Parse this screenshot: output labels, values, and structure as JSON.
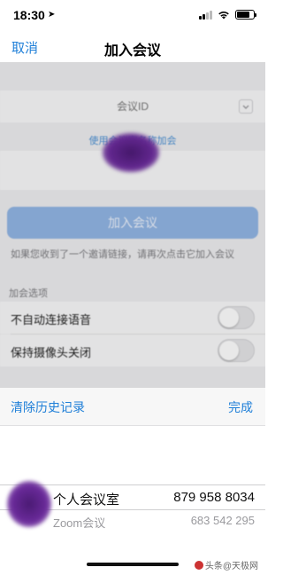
{
  "status": {
    "time": "18:30",
    "location_glyph": "➤"
  },
  "nav": {
    "cancel": "取消",
    "title": "加入会议"
  },
  "form": {
    "meeting_id_placeholder": "会议ID",
    "use_personal_room_link": "使用会议室名称加会",
    "join_button": "加入会议",
    "hint": "如果您收到了一个邀请链接，请再次点击它加入会议",
    "options_label": "加会选项",
    "options": [
      {
        "label": "不自动连接语音",
        "on": false
      },
      {
        "label": "保持摄像头关闭",
        "on": false
      }
    ]
  },
  "picker": {
    "clear_history": "清除历史记录",
    "done": "完成",
    "rows": [
      {
        "name": "个人会议室",
        "number": "879 958 8034",
        "selected": true
      },
      {
        "name": "Zoom会议",
        "number": "683 542 295",
        "selected": false
      }
    ]
  },
  "watermark": {
    "text": "头条@天极网"
  },
  "colors": {
    "accent": "#1f7fd8",
    "join_button": "#8fb2e0",
    "redaction": "#5a2288"
  }
}
